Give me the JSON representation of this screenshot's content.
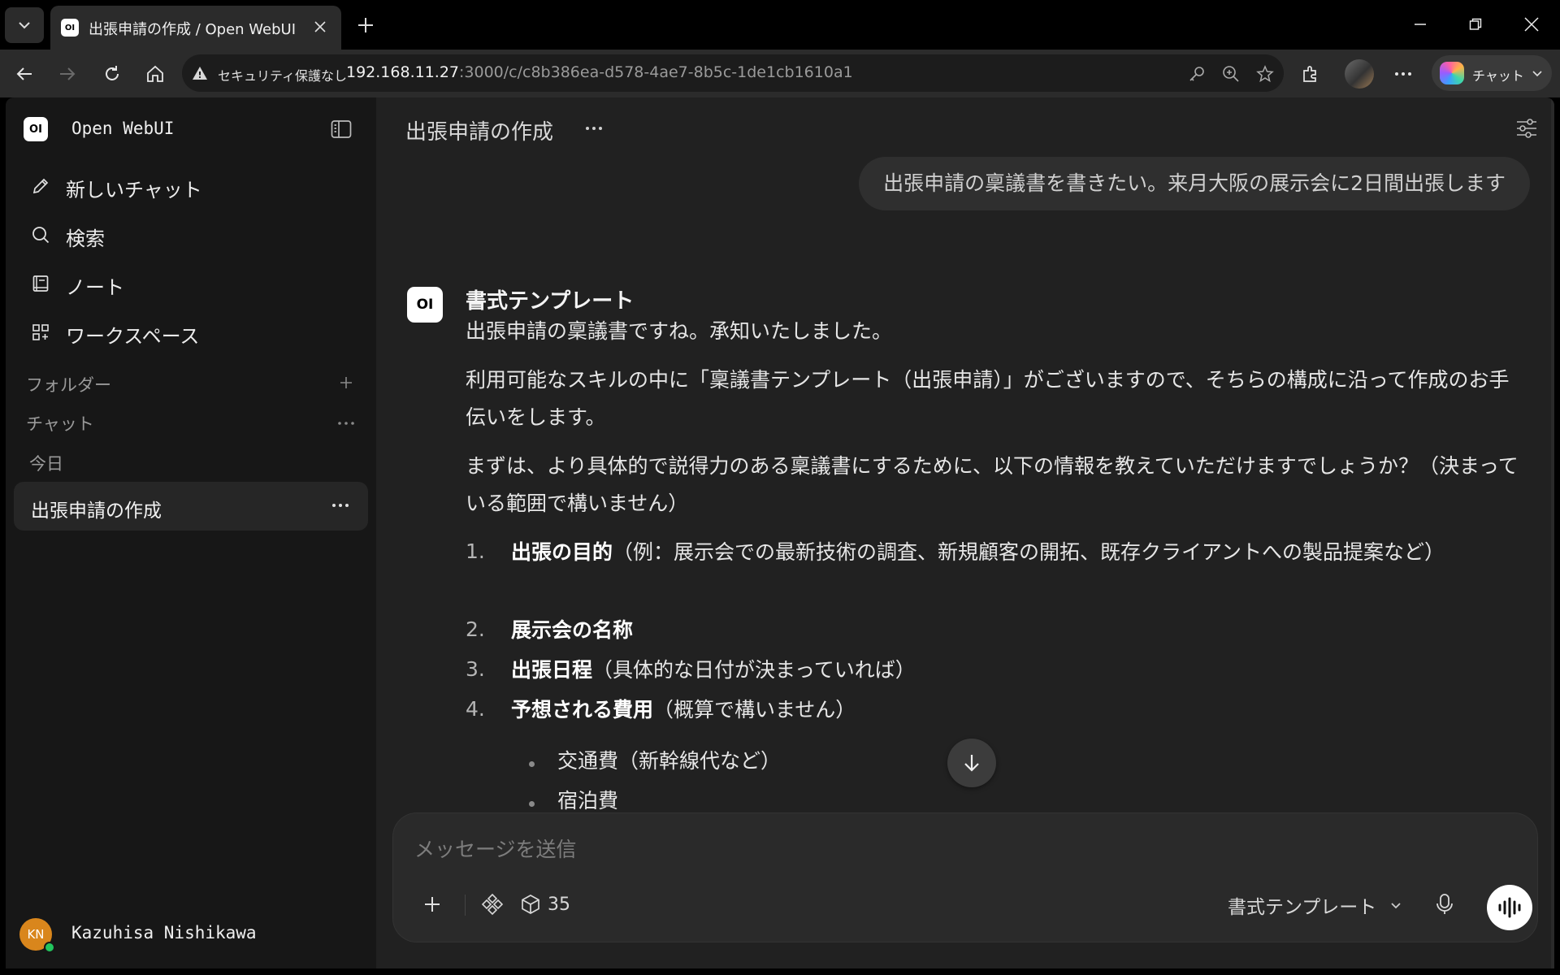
{
  "browser": {
    "tab_title": "出張申請の作成 / Open WebUI",
    "tab_favicon_text": "OI",
    "security_label": "セキュリティ保護なし",
    "url_host": "192.168.11.27",
    "url_path": ":3000/c/c8b386ea-d578-4ae7-8b5c-1de1cb1610a1",
    "copilot_label": "チャット"
  },
  "sidebar": {
    "logo_text": "OI",
    "app_name": "Open WebUI",
    "nav": [
      {
        "label": "新しいチャット",
        "icon": "pencil-icon"
      },
      {
        "label": "検索",
        "icon": "search-icon"
      },
      {
        "label": "ノート",
        "icon": "notebook-icon"
      },
      {
        "label": "ワークスペース",
        "icon": "grid-icon"
      }
    ],
    "folders_label": "フォルダー",
    "chats_label": "チャット",
    "today_label": "今日",
    "active_chat": "出張申請の作成",
    "user": {
      "initials": "KN",
      "name": "Kazuhisa Nishikawa"
    }
  },
  "chat": {
    "title": "出張申請の作成",
    "user_message": "出張申請の稟議書を書きたい。来月大阪の展示会に2日間出張します",
    "model_avatar_text": "OI",
    "model_name": "書式テンプレート",
    "p1": "出張申請の稟議書ですね。承知いたしました。",
    "p2": "利用可能なスキルの中に「稟議書テンプレート（出張申請）」がございますので、そちらの構成に沿って作成のお手伝いをします。",
    "p3": "まずは、より具体的で説得力のある稟議書にするために、以下の情報を教えていただけますでしょうか？（決まっている範囲で構いません）",
    "list": [
      {
        "num": "1.",
        "bold": "出張の目的",
        "rest": "（例：展示会での最新技術の調査、新規顧客の開拓、既存クライアントへの製品提案など）"
      },
      {
        "num": "2.",
        "bold": "展示会の名称",
        "rest": ""
      },
      {
        "num": "3.",
        "bold": "出張日程",
        "rest": "（具体的な日付が決まっていれば）"
      },
      {
        "num": "4.",
        "bold": "予想される費用",
        "rest": "（概算で構いません）"
      }
    ],
    "sub_list": [
      "交通費（新幹線代など）",
      "宿泊費"
    ]
  },
  "composer": {
    "placeholder": "メッセージを送信",
    "tool_count": "35",
    "model_select": "書式テンプレート"
  }
}
